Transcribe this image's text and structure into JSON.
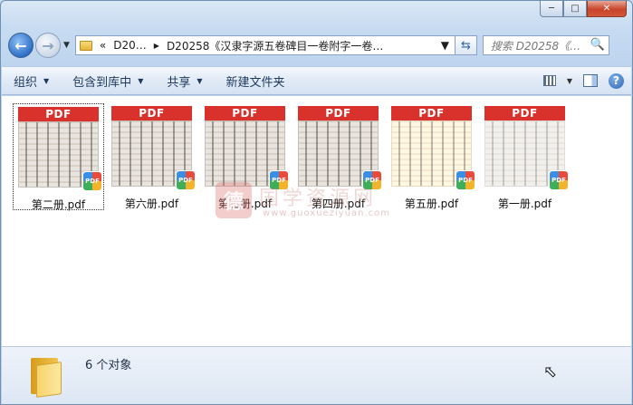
{
  "window": {
    "caption": {
      "minimize": "─",
      "maximize": "□",
      "close": "✕"
    }
  },
  "nav": {
    "back_icon": "arrow-left-icon",
    "forward_icon": "arrow-right-icon",
    "breadcrumb_root": "D20…",
    "breadcrumb_current": "D20258《汉隶字源五卷碑目一卷附字一卷…",
    "search_placeholder": "搜索 D20258《…"
  },
  "toolbar": {
    "organize": "组织",
    "include_library": "包含到库中",
    "share": "共享",
    "new_folder": "新建文件夹"
  },
  "files": [
    {
      "name": "第二册.pdf",
      "badge": "PDF",
      "selected": true
    },
    {
      "name": "第六册.pdf",
      "badge": "PDF",
      "selected": false
    },
    {
      "name": "第三册.pdf",
      "badge": "PDF",
      "selected": false
    },
    {
      "name": "第四册.pdf",
      "badge": "PDF",
      "selected": false
    },
    {
      "name": "第五册.pdf",
      "badge": "PDF",
      "selected": false
    },
    {
      "name": "第一册.pdf",
      "badge": "PDF",
      "selected": false
    }
  ],
  "watermark": {
    "logo": "德",
    "text": "国学资源网",
    "url": "www.guoxueziyuan.com"
  },
  "status": {
    "count": "6 个对象"
  },
  "colors": {
    "pdf_red": "#d9322c",
    "toolbar_text": "#1e395b"
  }
}
